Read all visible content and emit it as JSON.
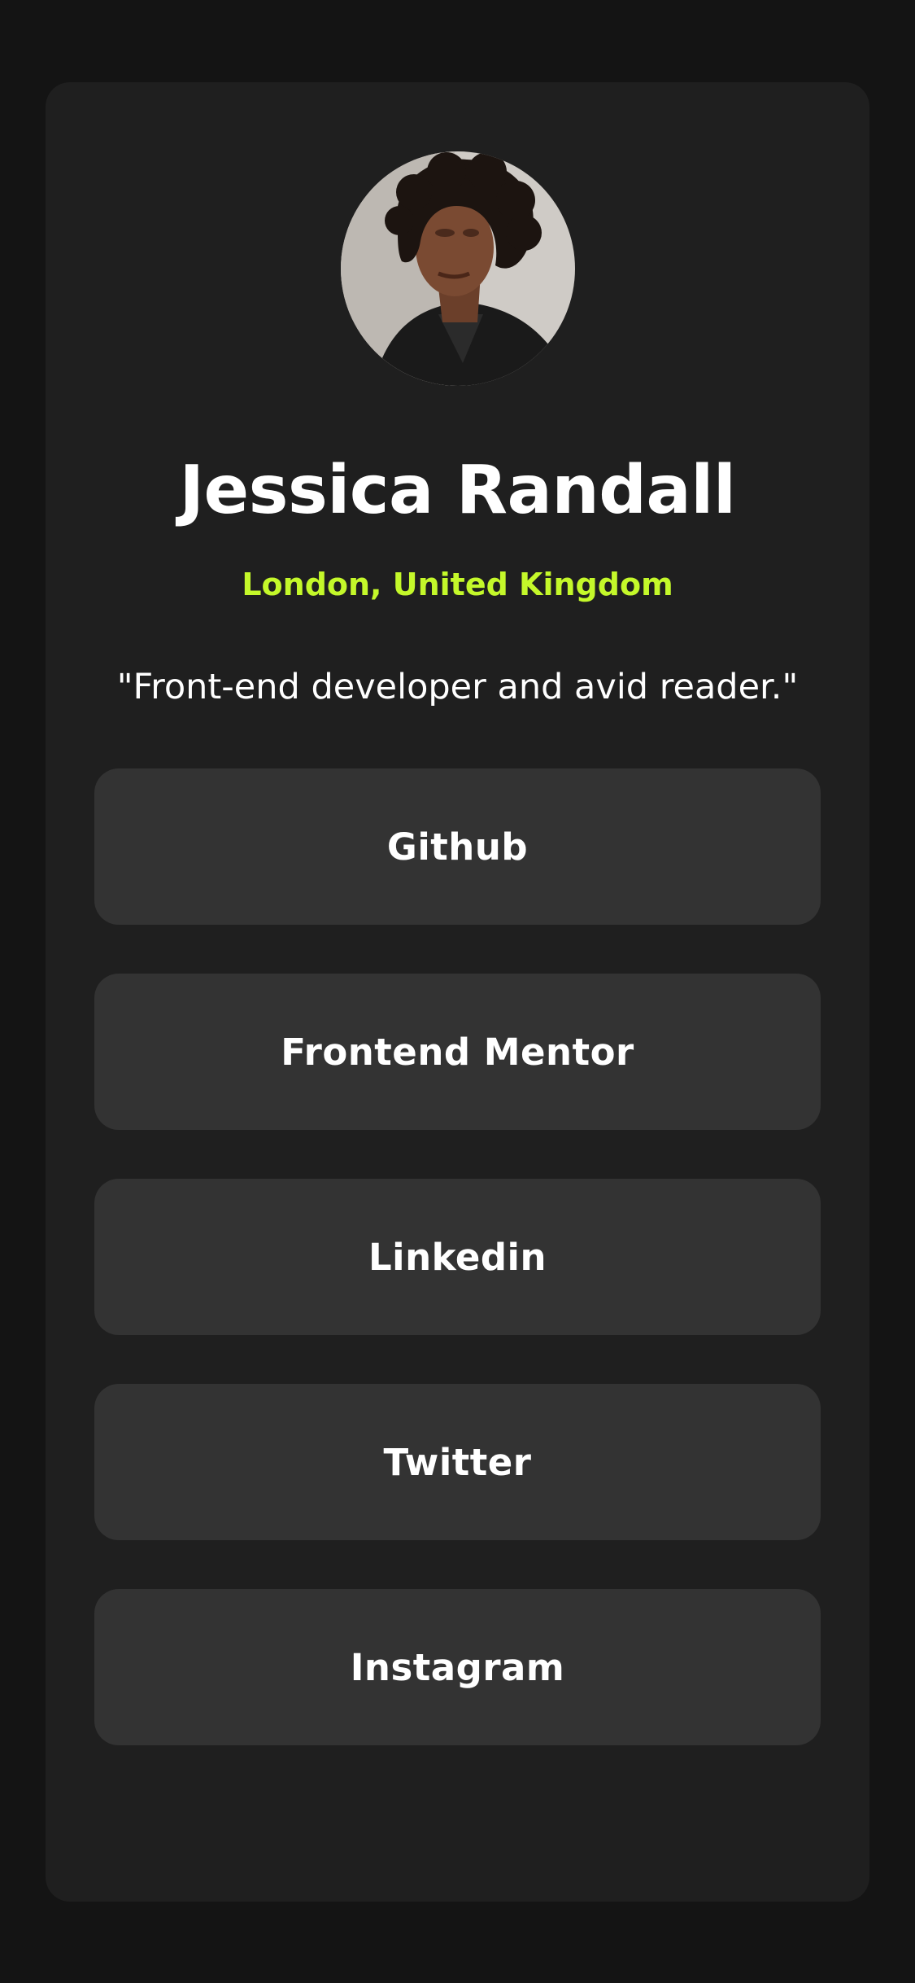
{
  "profile": {
    "name": "Jessica Randall",
    "location": "London, United Kingdom",
    "bio": "\"Front-end developer and avid reader.\""
  },
  "links": [
    {
      "label": "Github"
    },
    {
      "label": "Frontend Mentor"
    },
    {
      "label": "Linkedin"
    },
    {
      "label": "Twitter"
    },
    {
      "label": "Instagram"
    }
  ],
  "colors": {
    "background": "#141414",
    "card": "#1f1f1f",
    "button": "#333333",
    "accent": "#c4f82a",
    "text": "#ffffff"
  }
}
